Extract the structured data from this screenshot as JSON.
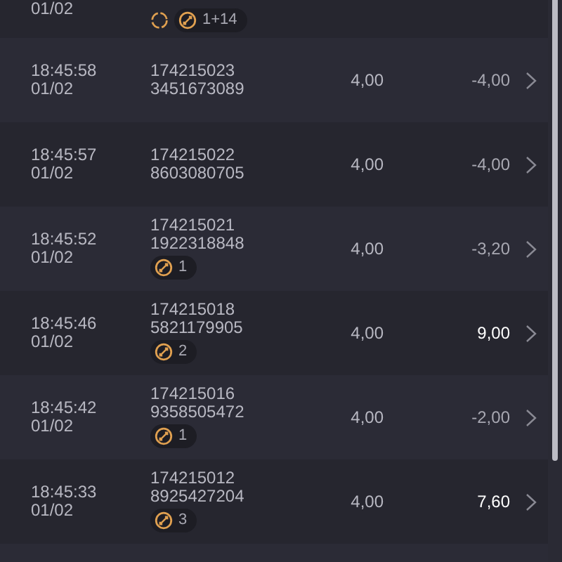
{
  "top_row": {
    "date": "01/02",
    "repeat": true,
    "badge": "1+14"
  },
  "rows": [
    {
      "time": "18:45:58",
      "date": "01/02",
      "id_line1": "174215023",
      "id_line2": "3451673089",
      "stake": "4,00",
      "result": "-4,00",
      "positive": false
    },
    {
      "time": "18:45:57",
      "date": "01/02",
      "id_line1": "174215022",
      "id_line2": "8603080705",
      "stake": "4,00",
      "result": "-4,00",
      "positive": false
    },
    {
      "time": "18:45:52",
      "date": "01/02",
      "id_line1": "174215021",
      "id_line2": "1922318848",
      "badge": "1",
      "stake": "4,00",
      "result": "-3,20",
      "positive": false
    },
    {
      "time": "18:45:46",
      "date": "01/02",
      "id_line1": "174215018",
      "id_line2": "5821179905",
      "badge": "2",
      "stake": "4,00",
      "result": "9,00",
      "positive": true
    },
    {
      "time": "18:45:42",
      "date": "01/02",
      "id_line1": "174215016",
      "id_line2": "9358505472",
      "badge": "1",
      "stake": "4,00",
      "result": "-2,00",
      "positive": false
    },
    {
      "time": "18:45:33",
      "date": "01/02",
      "id_line1": "174215012",
      "id_line2": "8925427204",
      "badge": "3",
      "stake": "4,00",
      "result": "7,60",
      "positive": true
    }
  ]
}
